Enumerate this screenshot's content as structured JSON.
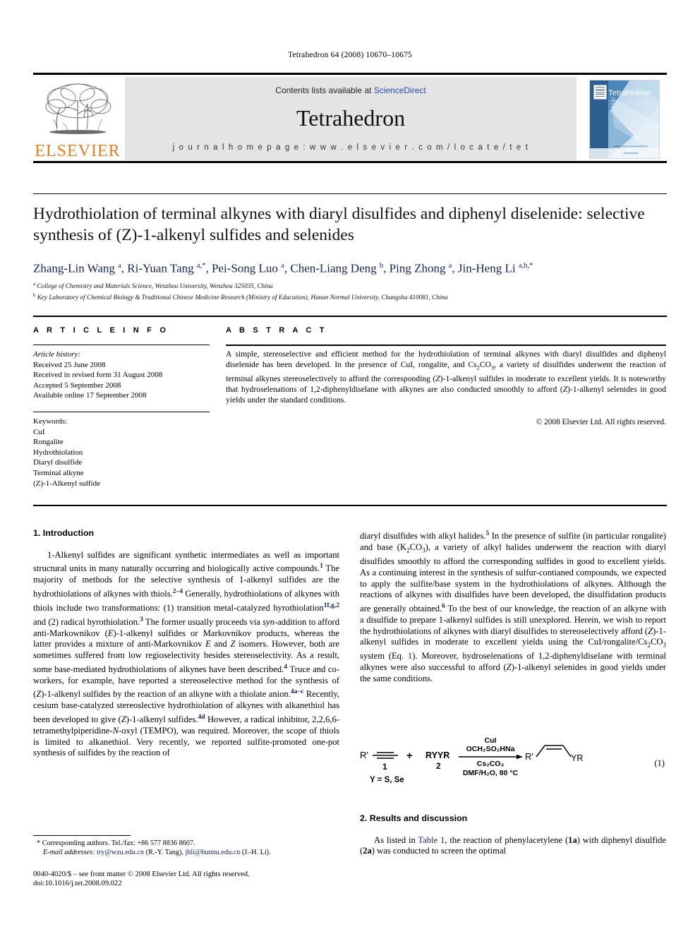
{
  "running_head": "Tetrahedron 64 (2008) 10670–10675",
  "masthead": {
    "contents_prefix": "Contents lists available at ",
    "sciencedirect": "ScienceDirect",
    "journal_title": "Tetrahedron",
    "homepage": "j o u r n a l   h o m e p a g e :   w w w . e l s e v i e r . c o m / l o c a t e / t e t",
    "elsevier_wordmark": "ELSEVIER",
    "elsevier_accent": "#E87C22",
    "cover_title": "Tetrahedron",
    "cover_subtitle": "The Internationl Journal for the Rapid Publication of Full Original Research Papers and Critical Reviews in Organic Chemistry",
    "cover_footer": "Available online at www.sciencedirect.com",
    "cover_sciencedirect": "ScienceDirect",
    "sciencedirect_color": "#2b49b8"
  },
  "article": {
    "title": "Hydrothiolation of terminal alkynes with diaryl disulfides and diphenyl diselenide: selective synthesis of (Z)-1-alkenyl sulfides and selenides",
    "authors": "Zhang-Lin Wang a, Ri-Yuan Tang a,*, Pei-Song Luo a, Chen-Liang Deng b, Ping Zhong a, Jin-Heng Li a,b,*",
    "affiliation_a": "College of Chemistry and Materials Science, Wenzhou University, Wenzhou 325035, China",
    "affiliation_b": "Key Laboratory of Chemical Biology & Traditional Chinese Medicine Research (Ministry of Education), Hunan Normal University, Changsha 410081, China"
  },
  "info": {
    "heading": "A R T I C L E   I N F O",
    "history_label": "Article history:",
    "history": [
      "Received 25 June 2008",
      "Received in revised form 31 August 2008",
      "Accepted 5 September 2008",
      "Available online 17 September 2008"
    ],
    "keywords_label": "Keywords:",
    "keywords": [
      "CuI",
      "Rongalite",
      "Hydrothiolation",
      "Diaryl disulfide",
      "Terminal alkyne",
      "(Z)-1-Alkenyl sulfide"
    ]
  },
  "abstract": {
    "heading": "A B S T R A C T",
    "text": "A simple, stereoselective and efficient method for the hydrothiolation of terminal alkynes with diaryl disulfides and diphenyl diselenide has been developed. In the presence of CuI, rongalite, and Cs2CO3, a variety of disulfides underwent the reaction of terminal alkynes stereoselectively to afford the corresponding (Z)-1-alkenyl sulfides in moderate to excellent yields. It is noteworthy that hydroselenations of 1,2-diphenyldiselane with alkynes are also conducted smoothly to afford (Z)-1-alkenyl selenides in good yields under the standard conditions.",
    "copyright": "© 2008 Elsevier Ltd. All rights reserved."
  },
  "body": {
    "intro_heading": "1. Introduction",
    "results_heading": "2. Results and discussion",
    "intro_p1_part1": "1-Alkenyl sulfides are significant synthetic intermediates as well as important structural units in many naturally occurring and biologically active compounds.",
    "intro_ref1": "1",
    "intro_p1_part2": " The majority of methods for the selective synthesis of 1-alkenyl sulfides are the hydrothiolations of alkynes with thiols.",
    "intro_ref2": "2–4",
    "intro_p1_part3": " Generally, hydrothiolations of alkynes with thiols include two transformations: (1) transition metal-catalyzed hyrothiolation",
    "intro_ref3": "1f,g,2",
    "intro_p1_part4": " and (2) radical hyrothiolation.",
    "intro_ref4": "3",
    "intro_p1_part5": " The former usually proceeds via syn-addition to afford anti-Markownikov (E)-1-alkenyl sulfides or Markovnikov products, whereas the latter provides a mixture of anti-Markovnikov E and Z isomers. However, both are sometimes suffered from low regioselectivity besides stereoselectivity. As a result, some base-mediated hydrothiolations of alkynes have been described.",
    "intro_ref5": "4",
    "intro_p1_part6": " Truce and co-workers, for example, have reported a stereoselective method for the synthesis of (Z)-1-alkenyl sulfides by the reaction of an alkyne with a thiolate anion.",
    "intro_ref6": "4a–c",
    "intro_p1_part7": " Recently, cesium base-catalyzed stereoslective hydrothiolation of alkynes with alkanethiol has been developed to give (Z)-1-alkenyl sulfides.",
    "intro_ref7": "4d",
    "intro_p1_part8": " However, a radical inhibitor, 2,2,6,6-tetramethylpiperidine-N-oxyl (TEMPO), was required. Moreover, the scope of thiols is limited to alkanethiol. Very recently, we reported sulfite-promoted one-pot synthesis of sulfides by the reaction of diaryl disulfides with alkyl halides.",
    "intro_ref8": "5",
    "intro_p2_part1": " In the presence of sulfite (in particular rongalite) and base (K2CO3), a variety of alkyl halides underwent the reaction with diaryl disulfides smoothly to afford the corresponding sulfides in good to excellent yields. As a continuing interest in the synthesis of sulfur-contianed compounds, we expected to apply the sulfite/base system in the hydrothiolations of alkynes. Although the reactions of alkynes with disulfides have been developed, the disulfidation products are generally obtained.",
    "intro_ref9": "6",
    "intro_p2_part2": " To the best of our knowledge, the reaction of an alkyne with a disulfide to prepare 1-alkenyl sulfides is still unexplored. Herein, we wish to report the hydrothiolations of alkynes with diaryl disulfides to stereoselectively afford (Z)-1-alkenyl sulfides in moderate to excellent yields using the CuI/rongalite/Cs2CO3 system (Eq. 1). Moreover, hydroselenations of 1,2-diphenyldiselane with terminal alkynes were also successful to afford (Z)-1-alkenyl selenides in good yields under the same conditions.",
    "results_p1_part1": "As listed in ",
    "results_table_link": "Table 1",
    "results_p1_part2": ", the reaction of phenylacetylene (1a) with diphenyl disulfide (2a) was conducted to screen the optimal"
  },
  "equation": {
    "number": "(1)",
    "reactant1_label": "R'",
    "reactant1_number": "1",
    "y_note": "Y = S, Se",
    "plus": "+",
    "reactant2_label": "RYYR",
    "reactant2_number": "2",
    "cond_line1": "CuI",
    "cond_line2": "OCH2SO2HNa",
    "cond_line3": "Cs2CO3",
    "cond_line4": "DMF/H2O, 80 °C",
    "product_left": "R'",
    "product_right": "YR"
  },
  "footnote": {
    "star": "*",
    "corresponding": "Corresponding authors. Tel./fax: +86 577 8836 8607.",
    "email_label": "E-mail addresses:",
    "email1": "try@wzu.edu.cn",
    "email1_owner": "(R.-Y. Tang)",
    "email2": "jhli@hunnu.edu.cn",
    "email2_owner": "(J.-H. Li).",
    "link_color": "#16225c"
  },
  "imprint": {
    "line1": "0040-4020/$ – see front matter © 2008 Elsevier Ltd. All rights reserved.",
    "line2": "doi:10.1016/j.tet.2008.09.022"
  }
}
